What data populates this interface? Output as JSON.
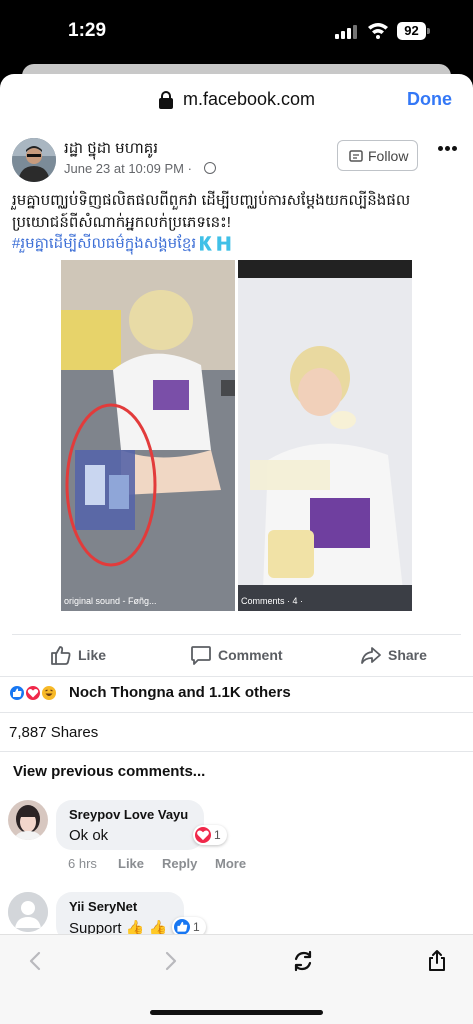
{
  "status_bar": {
    "time": "1:29",
    "battery": "92"
  },
  "browser": {
    "url": "m.facebook.com",
    "done_label": "Done"
  },
  "post": {
    "author": "រដ្ឋា ថ្នុដា មហាគូរ",
    "date": "June 23 at 10:09 PM ·",
    "follow_label": "Follow",
    "text": "រួមគ្នាបញ្ឈប់ទិញផលិតផលពីពួកវា ដើម្បីបញ្ឈប់ការសម្តែងយកល្បីនិងផលប្រយោជន៍ពីសំណាក់អ្នកលក់ប្រភេទនេះ!",
    "hashtag": "#រួមគ្នាដើម្បីសីលធម៌ក្នុងសង្គមខ្មែរ🇰🇭",
    "image_left_caption": "original sound - Føñg...",
    "image_right_caption": "Comments · 4 ·"
  },
  "actions": {
    "like": "Like",
    "comment": "Comment",
    "share": "Share"
  },
  "reactions": {
    "summary": "Noch Thongna and 1.1K others"
  },
  "shares": "7,887 Shares",
  "view_previous": "View previous comments...",
  "comments": [
    {
      "name": "Sreypov Love Vayu",
      "text": "Ok ok",
      "reaction_count": "1",
      "time": "6 hrs",
      "like": "Like",
      "reply": "Reply",
      "more": "More"
    },
    {
      "name": "Yii SeryNet",
      "text": "Support 👍 👍",
      "reaction_count": "1"
    }
  ],
  "colors": {
    "accent": "#3478f6",
    "like_blue": "#1877f2",
    "love_red": "#f0284a",
    "haha_yellow": "#f7b928",
    "hashtag": "#3d6fd6"
  },
  "icons": [
    "lock-icon",
    "globe-icon",
    "follow-icon",
    "more-icon",
    "like-icon",
    "comment-icon",
    "share-icon",
    "back-icon",
    "forward-icon",
    "reload-icon",
    "share-sheet-icon"
  ]
}
